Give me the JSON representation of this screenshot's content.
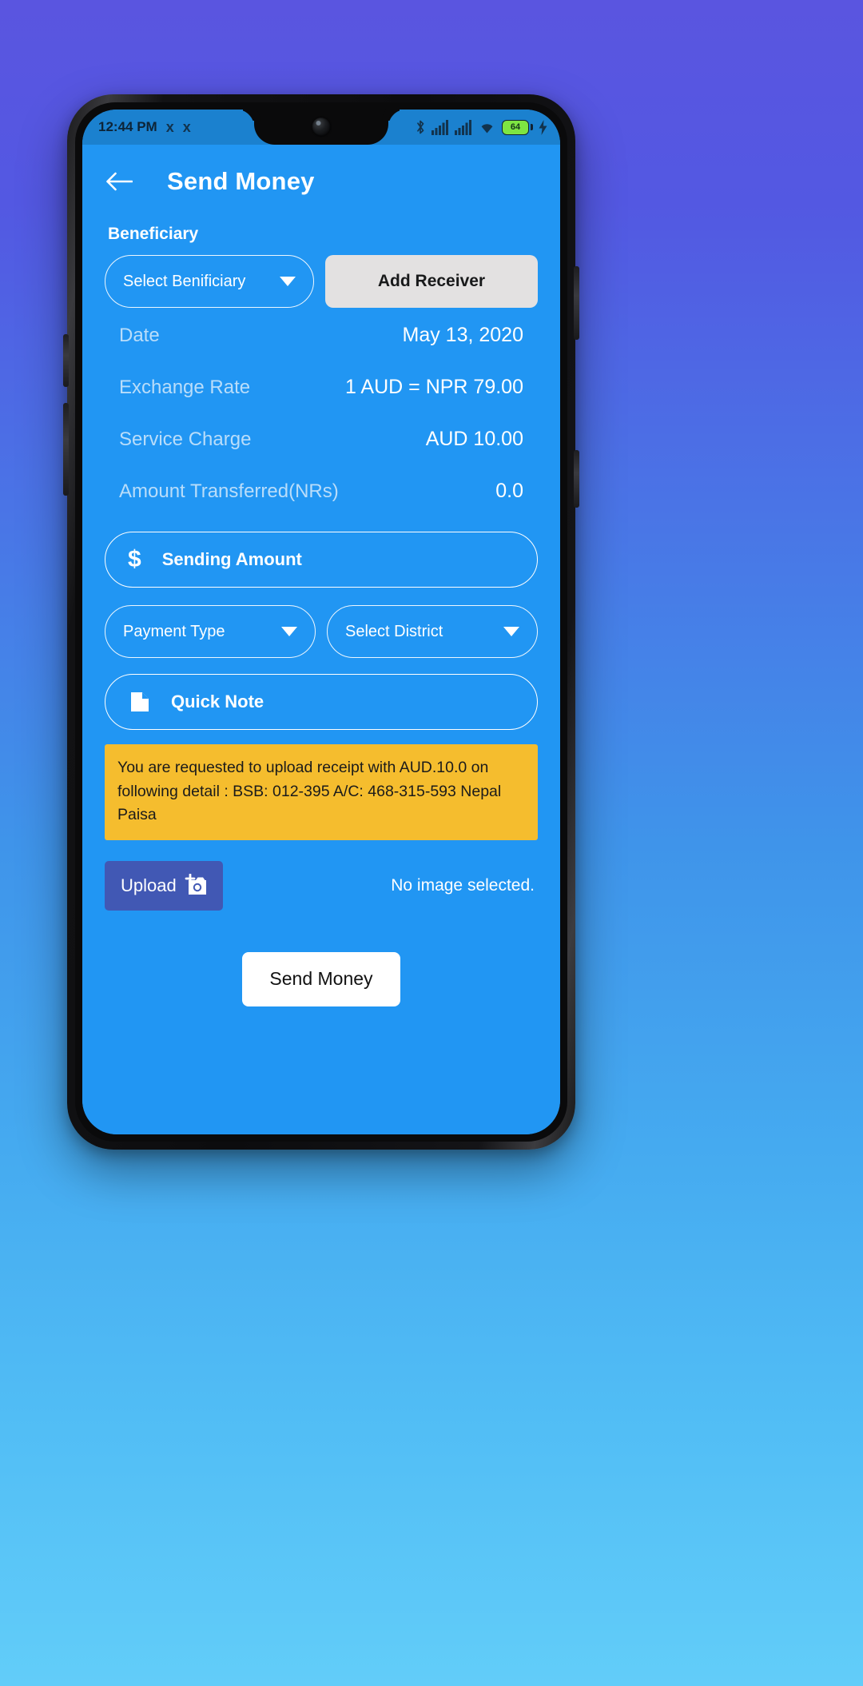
{
  "status_bar": {
    "time": "12:44 PM",
    "left_icons": [
      "p-icon",
      "p-icon"
    ],
    "right_icons": [
      "bluetooth-icon",
      "signal-icon",
      "signal-icon",
      "wifi-icon"
    ],
    "battery_level": "64"
  },
  "appbar": {
    "back_icon": "back-arrow-icon",
    "title": "Send Money"
  },
  "form": {
    "section_label": "Beneficiary",
    "beneficiary_placeholder": "Select Benificiary",
    "add_receiver_label": "Add Receiver",
    "sending_amount_placeholder": "Sending Amount",
    "sending_amount_icon": "dollar-icon",
    "payment_type_placeholder": "Payment Type",
    "district_placeholder": "Select District",
    "quick_note_placeholder": "Quick Note",
    "quick_note_icon": "note-icon"
  },
  "details": [
    {
      "label": "Date",
      "value": "May 13, 2020"
    },
    {
      "label": "Exchange Rate",
      "value": "1 AUD = NPR 79.00"
    },
    {
      "label": "Service Charge",
      "value": "AUD 10.00"
    },
    {
      "label": "Amount Transferred(NRs)",
      "value": "0.0"
    }
  ],
  "notice": {
    "text": "You are requested to upload receipt with AUD.10.0 on following detail : BSB: 012-395  A/C: 468-315-593 Nepal Paisa"
  },
  "upload": {
    "button_label": "Upload",
    "button_icon": "add-photo-icon",
    "status_text": "No image selected."
  },
  "submit": {
    "label": "Send Money"
  },
  "colors": {
    "app_background": "#2196f3",
    "status_bar": "#1b81cf",
    "notice_background": "#f5bd2e",
    "upload_button": "#4158b4",
    "add_receiver_button": "#e3e1e1",
    "battery": "#7ee542"
  }
}
